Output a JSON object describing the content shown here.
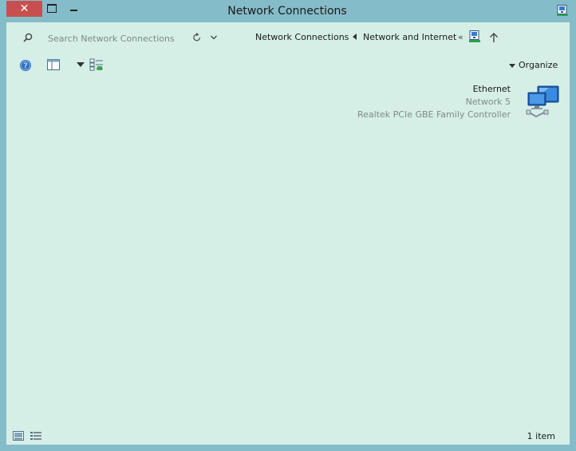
{
  "window": {
    "title": "Network Connections",
    "close_label": "✕"
  },
  "address_bar": {
    "search_placeholder": "Search Network Connections",
    "overflow_chevron": "«",
    "breadcrumbs": [
      "Network and Internet",
      "Network Connections"
    ]
  },
  "toolbar": {
    "organize_label": "Organize"
  },
  "items": [
    {
      "name": "Ethernet",
      "network": "Network  5",
      "adapter": "Realtek PCIe GBE Family Controller"
    }
  ],
  "status": {
    "item_count": "1 item"
  },
  "colors": {
    "frame": "#85bcc9",
    "content_bg": "#d5efe7",
    "close_button": "#c7504f",
    "subtext": "#808a88"
  }
}
